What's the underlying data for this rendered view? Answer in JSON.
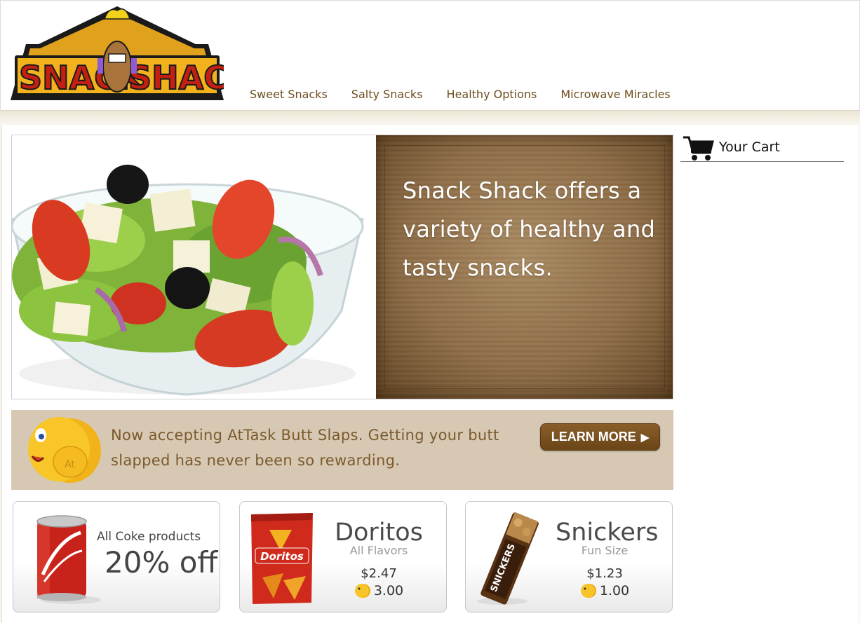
{
  "brand": {
    "logo_text": "SNACK SHACK"
  },
  "nav": [
    {
      "label": "Sweet Snacks"
    },
    {
      "label": "Salty Snacks"
    },
    {
      "label": "Healthy Options"
    },
    {
      "label": "Microwave Miracles"
    }
  ],
  "hero": {
    "text": "Snack Shack offers a variety of healthy and tasty snacks.",
    "image": "salad-bowl"
  },
  "cart": {
    "label": "Your Cart",
    "icon": "shopping-cart-icon"
  },
  "promo": {
    "text": "Now accepting AtTask Butt Slaps.  Getting your butt slapped has never been so rewarding.",
    "button_label": "LEARN MORE",
    "icon": "butt-smiley-icon"
  },
  "products": {
    "coke": {
      "line1": "All Coke products",
      "line2": "20% off"
    },
    "doritos": {
      "name": "Doritos",
      "subtitle": "All Flavors",
      "price": "$2.47",
      "slaps": "3.00"
    },
    "snickers": {
      "name": "Snickers",
      "subtitle": "Fun Size",
      "price": "$1.23",
      "slaps": "1.00"
    }
  },
  "colors": {
    "nav_text": "#6e4f1e",
    "promo_bg": "#d7c8b4",
    "promo_text": "#7a5a2c",
    "button_bg": "#7a5222"
  }
}
